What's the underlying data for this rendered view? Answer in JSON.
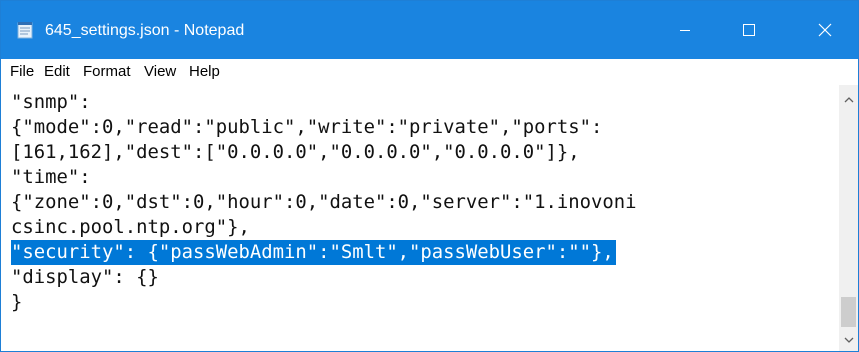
{
  "window": {
    "title": "645_settings.json - Notepad",
    "controls": {
      "minimize": "minimize",
      "maximize": "maximize",
      "close": "close"
    },
    "accent_color": "#1a84e0"
  },
  "menubar": {
    "items": [
      "File",
      "Edit",
      "Format",
      "View",
      "Help"
    ]
  },
  "editor": {
    "lines": [
      "\"snmp\":",
      "{\"mode\":0,\"read\":\"public\",\"write\":\"private\",\"ports\":",
      "[161,162],\"dest\":[\"0.0.0.0\",\"0.0.0.0\",\"0.0.0.0\"]},",
      "\"time\":",
      "{\"zone\":0,\"dst\":0,\"hour\":0,\"date\":0,\"server\":\"1.inovoni",
      "csinc.pool.ntp.org\"},",
      "\"security\": {\"passWebAdmin\":\"Smlt\",\"passWebUser\":\"\"},",
      "\"display\": {}",
      "}"
    ],
    "selected_line_index": 6,
    "selection_color": "#0078d7"
  },
  "scrollbar": {
    "up_icon": "chevron-up-icon",
    "down_icon": "chevron-down-icon"
  }
}
